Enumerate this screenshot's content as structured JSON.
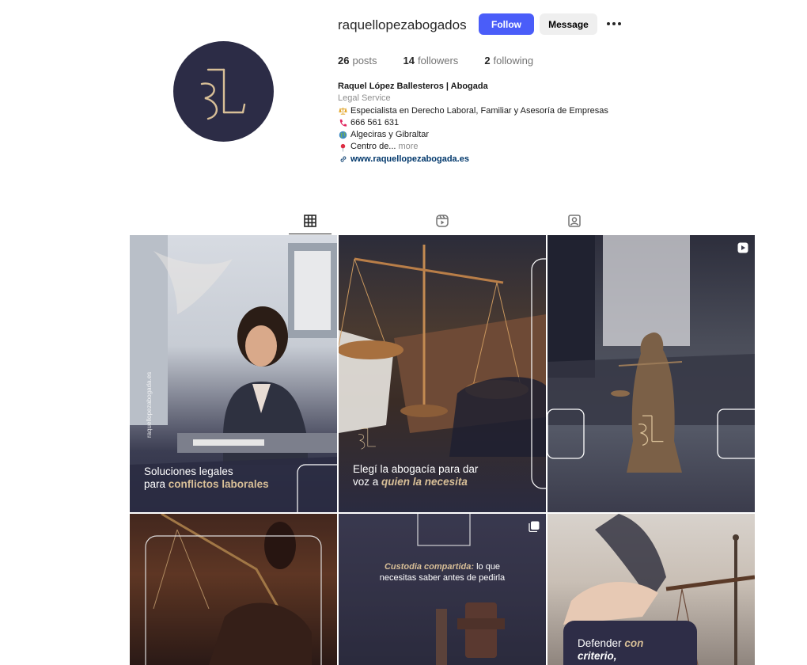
{
  "profile": {
    "username": "raquellopezabogados",
    "follow_label": "Follow",
    "message_label": "Message",
    "avatar_monogram": "RL",
    "stats": {
      "posts_count": "26",
      "posts_label": "posts",
      "followers_count": "14",
      "followers_label": "followers",
      "following_count": "2",
      "following_label": "following"
    },
    "bio": {
      "name": "Raquel López Ballesteros | Abogada",
      "category": "Legal Service",
      "line1": "Especialista en Derecho Laboral, Familiar y Asesoría de Empresas",
      "line2": "666 561 631",
      "line3": "Algeciras y Gibraltar",
      "line4": "Centro de...",
      "more_label": "more",
      "website": "www.raquellopezabogada.es"
    }
  },
  "tabs": [
    "posts-grid-icon",
    "reels-icon",
    "tagged-icon"
  ],
  "posts": [
    {
      "caption_plain": "Soluciones legales",
      "caption_plain2": "para",
      "caption_gold": "conflictos laborales",
      "side_text": "raquellopezabogada.es"
    },
    {
      "caption_plain": "Elegí la abogacía para dar",
      "caption_plain2": "voz a",
      "caption_gold": "quien la necesita"
    },
    {
      "overlay": "reel-icon",
      "monogram": "RL"
    },
    {},
    {
      "caption_gold": "Custodia compartida:",
      "caption_plain": "lo que",
      "caption_plain2": "necesitas saber antes de pedirla",
      "overlay": "carousel-icon"
    },
    {
      "caption_plain": "Defender",
      "caption_gold": "con",
      "caption_gold2": "criterio,"
    }
  ],
  "colors": {
    "follow_bg": "#4a5df9",
    "avatar_bg": "#2c2c46",
    "gold": "#d8bf97",
    "link": "#00376b"
  }
}
